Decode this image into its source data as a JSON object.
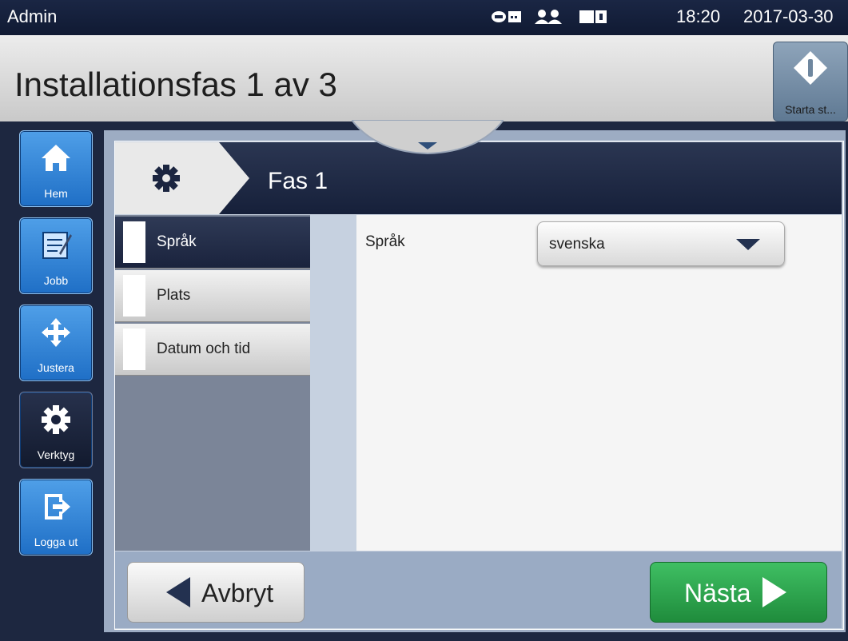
{
  "status_bar": {
    "user": "Admin",
    "time": "18:20",
    "date": "2017-03-30",
    "icons": [
      "link-status-icon",
      "users-icon",
      "printer-status-icon"
    ]
  },
  "header": {
    "title": "Installationsfas 1 av 3",
    "start_button_label": "Starta st..."
  },
  "sidebar": {
    "items": [
      {
        "label": "Hem",
        "icon": "home-icon"
      },
      {
        "label": "Jobb",
        "icon": "job-icon"
      },
      {
        "label": "Justera",
        "icon": "move-icon"
      },
      {
        "label": "Verktyg",
        "icon": "gear-icon"
      },
      {
        "label": "Logga ut",
        "icon": "logout-icon"
      }
    ]
  },
  "phase": {
    "title": "Fas 1",
    "icon": "gear-icon"
  },
  "steps": [
    {
      "label": "Språk",
      "selected": true
    },
    {
      "label": "Plats",
      "selected": false
    },
    {
      "label": "Datum och tid",
      "selected": false
    }
  ],
  "form": {
    "field_label": "Språk",
    "selected_value": "svenska"
  },
  "footer": {
    "cancel_label": "Avbryt",
    "next_label": "Nästa"
  },
  "colors": {
    "nav_blue": "#1f6fc6",
    "dark_navy": "#16203a",
    "next_green": "#1f8c3c"
  }
}
